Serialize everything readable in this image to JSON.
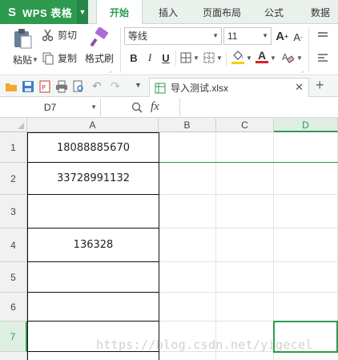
{
  "app": {
    "name": "WPS 表格",
    "logo_letter": "S"
  },
  "tabs": [
    {
      "label": "开始",
      "active": true
    },
    {
      "label": "插入",
      "active": false
    },
    {
      "label": "页面布局",
      "active": false
    },
    {
      "label": "公式",
      "active": false
    },
    {
      "label": "数据",
      "active": false
    }
  ],
  "ribbon": {
    "paste_label": "粘贴",
    "cut_label": "剪切",
    "copy_label": "复制",
    "format_painter_label": "格式刷",
    "font_name": "等线",
    "font_size": "11",
    "bold": "B",
    "italic": "I",
    "underline": "U",
    "grow_font": "A",
    "shrink_font": "A",
    "font_color_letter": "A"
  },
  "quick_access": {
    "doc_name": "导入测试.xlsx"
  },
  "formula_bar": {
    "name_box": "D7",
    "fx": "fx",
    "value": ""
  },
  "sheet": {
    "columns": [
      "A",
      "B",
      "C",
      "D"
    ],
    "selected_column": "D",
    "rows": [
      {
        "n": "1",
        "A": "18088885670"
      },
      {
        "n": "2",
        "A": "33728991132"
      },
      {
        "n": "3",
        "A": ""
      },
      {
        "n": "4",
        "A": "136328"
      },
      {
        "n": "5",
        "A": ""
      },
      {
        "n": "6",
        "A": ""
      },
      {
        "n": "7",
        "A": ""
      }
    ],
    "selected_row": "7",
    "active_cell": "D7"
  },
  "watermark": "https://blog.csdn.net/yigecel",
  "colors": {
    "accent": "#2d9a4e",
    "font_color_underline": "#e02020",
    "fill_color_underline": "#f5d000"
  }
}
